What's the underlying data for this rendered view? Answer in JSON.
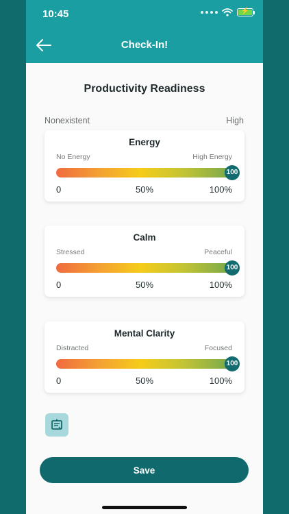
{
  "status_bar": {
    "time": "10:45"
  },
  "header": {
    "title": "Check-In!"
  },
  "page": {
    "title": "Productivity Readiness",
    "scale_min": "Nonexistent",
    "scale_max": "High"
  },
  "ticks": {
    "min": "0",
    "mid": "50%",
    "max": "100%"
  },
  "cards": [
    {
      "title": "Energy",
      "left_label": "No Energy",
      "right_label": "High Energy",
      "value": 100
    },
    {
      "title": "Calm",
      "left_label": "Stressed",
      "right_label": "Peaceful",
      "value": 100
    },
    {
      "title": "Mental Clarity",
      "left_label": "Distracted",
      "right_label": "Focused",
      "value": 100
    }
  ],
  "save_label": "Save",
  "colors": {
    "header": "#1a9ea2",
    "accent": "#10696c",
    "gradient_start": "#ef6b3f",
    "gradient_mid": "#f5cc1a",
    "gradient_end": "#77a84c"
  },
  "icons": {
    "back": "arrow-left-icon",
    "note": "notepad-icon"
  }
}
